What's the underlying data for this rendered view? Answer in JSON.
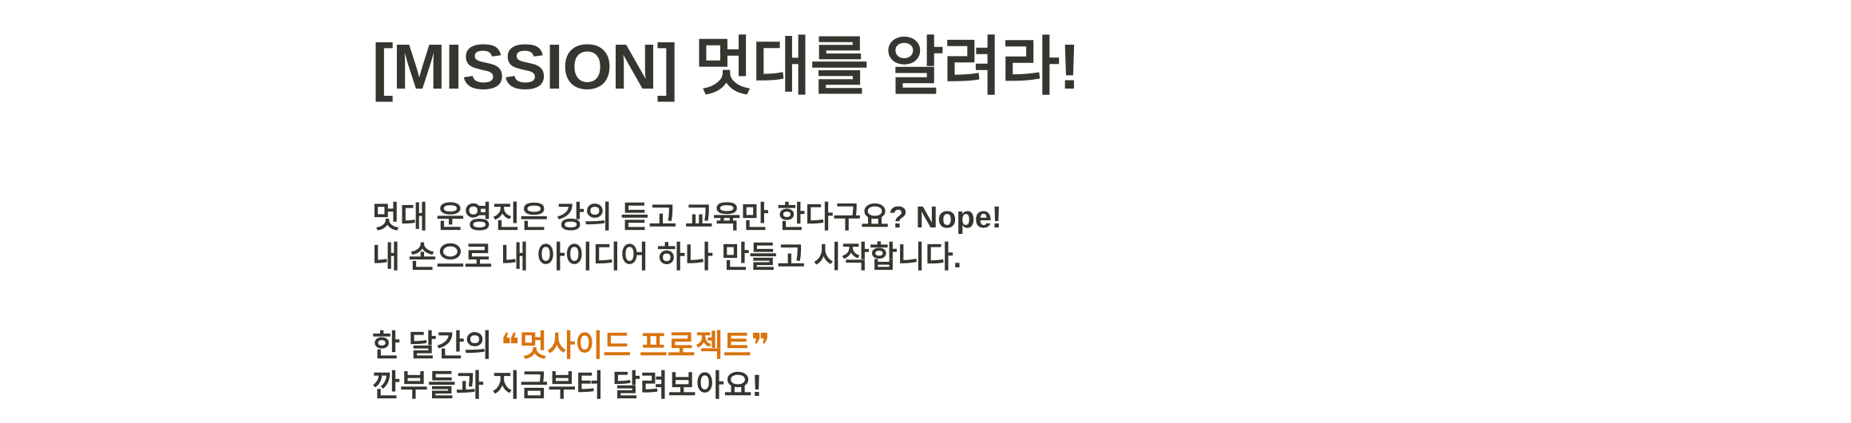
{
  "page": {
    "title": "[MISSION] 멋대를 알려라!"
  },
  "body": {
    "paragraph1": {
      "line1": "멋대 운영진은  강의 듣고 교육만 한다구요? Nope!",
      "line2": "내 손으로 내 아이디어 하나 만들고 시작합니다."
    },
    "paragraph2": {
      "line1_prefix": "한 달간의 ",
      "open_quote": "❝",
      "highlight": "멋사이드 프로젝트",
      "close_quote": "❞",
      "line2": "깐부들과 지금부터 달려보아요!"
    }
  },
  "colors": {
    "text": "#37352f",
    "highlight": "#d9730d",
    "background": "#ffffff"
  }
}
